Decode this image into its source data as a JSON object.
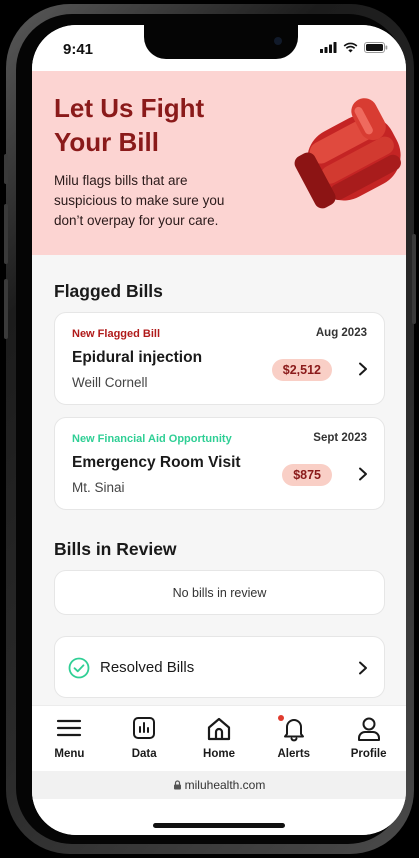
{
  "status_bar": {
    "time": "9:41"
  },
  "hero": {
    "title": "Let Us Fight Your Bill",
    "description": "Milu flags bills that are suspicious to make sure you don’t overpay for your care.",
    "image_icon": "boxing-glove-icon"
  },
  "flagged": {
    "title": "Flagged Bills",
    "cards": [
      {
        "tag": "New Flagged Bill",
        "tag_color": "#b01a1a",
        "date": "Aug 2023",
        "title": "Epidural injection",
        "provider": "Weill Cornell",
        "amount": "$2,512"
      },
      {
        "tag": "New Financial Aid Opportunity",
        "tag_color": "#2fcf95",
        "date": "Sept 2023",
        "title": "Emergency Room Visit",
        "provider": "Mt. Sinai",
        "amount": "$875"
      }
    ]
  },
  "review": {
    "title": "Bills in Review",
    "empty_text": "No bills in review"
  },
  "resolved": {
    "label": "Resolved Bills",
    "icon": "check-circle-icon",
    "icon_color": "#2fcf95"
  },
  "tabs": [
    {
      "label": "Menu",
      "icon": "menu-icon"
    },
    {
      "label": "Data",
      "icon": "chart-icon"
    },
    {
      "label": "Home",
      "icon": "home-icon"
    },
    {
      "label": "Alerts",
      "icon": "bell-icon"
    },
    {
      "label": "Profile",
      "icon": "user-icon"
    }
  ],
  "browser": {
    "url": "miluhealth.com"
  },
  "colors": {
    "accent": "#8a1a1a",
    "hero_bg": "#fcd4d2",
    "amount_bg": "#f9cfc6",
    "alert_dot": "#e03b2e"
  }
}
